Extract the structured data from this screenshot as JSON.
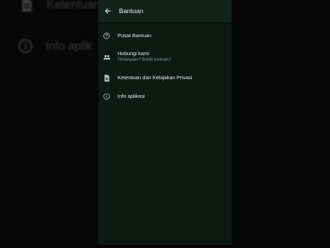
{
  "background": {
    "row1_text": "Ketentuan",
    "row2_text": "Info aplik"
  },
  "appbar": {
    "title": "Bantuan",
    "back_icon": "arrow-back-icon"
  },
  "menu": {
    "items": [
      {
        "label": "Pusat Bantuan",
        "sub": "",
        "icon": "help-circle-icon"
      },
      {
        "label": "Hubungi kami",
        "sub": "Pertanyaan? Butuh bantuan?",
        "icon": "people-icon"
      },
      {
        "label": "Ketentuan dan Kebijakan Privasi",
        "sub": "",
        "icon": "document-icon"
      },
      {
        "label": "Info aplikasi",
        "sub": "",
        "icon": "info-icon"
      }
    ]
  },
  "colors": {
    "screen_bg": "#0d1a14",
    "appbar_bg": "#14221c",
    "text_primary": "#e9edef",
    "text_secondary": "#8696a0"
  }
}
